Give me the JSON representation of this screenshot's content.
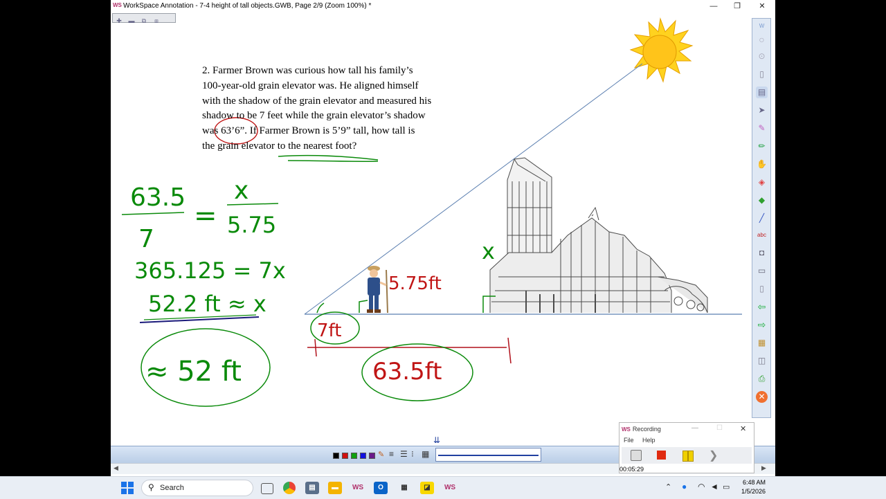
{
  "window": {
    "title": "WorkSpace Annotation - 7-4 height of tall objects.GWB, Page 2/9  (Zoom 100%) *",
    "logo": "WS",
    "controls": {
      "minimize": "—",
      "maximize": "❐",
      "close": "✕"
    }
  },
  "problem": {
    "lines": [
      "2.  Farmer Brown was curious how tall his family’s",
      "100-year-old grain elevator was.  He aligned himself",
      "with the shadow of the grain elevator and measured his",
      "shadow to be 7 feet while the grain elevator’s shadow",
      "was 63’6”.  If Farmer Brown is 5’9” tall, how tall is",
      "the grain elevator to the nearest foot?"
    ]
  },
  "handwriting": {
    "fraction_left_num": "63.5",
    "fraction_left_den": "7",
    "equals": "=",
    "fraction_right_num": "x",
    "fraction_right_den": "5.75",
    "step2": "365.125 = 7x",
    "step3": "52.2 ft ≈ x",
    "answer": "≈ 52 ft",
    "farmer_height": "5.75ft",
    "farmer_shadow": "7ft",
    "elevator_shadow": "63.5ft",
    "elevator_label": "x"
  },
  "palette": {
    "colors": [
      "#000000",
      "#d01010",
      "#10a010",
      "#1010e0",
      "#6a1a8a"
    ],
    "page_down_glyph": "⇊"
  },
  "recorder": {
    "logo": "WS",
    "title": "Recording",
    "menu": [
      "File",
      "Help"
    ],
    "time": "00:05:29"
  },
  "taskbar": {
    "search_placeholder": "Search",
    "time": "6:48 AM",
    "date": "1/5/2026"
  }
}
